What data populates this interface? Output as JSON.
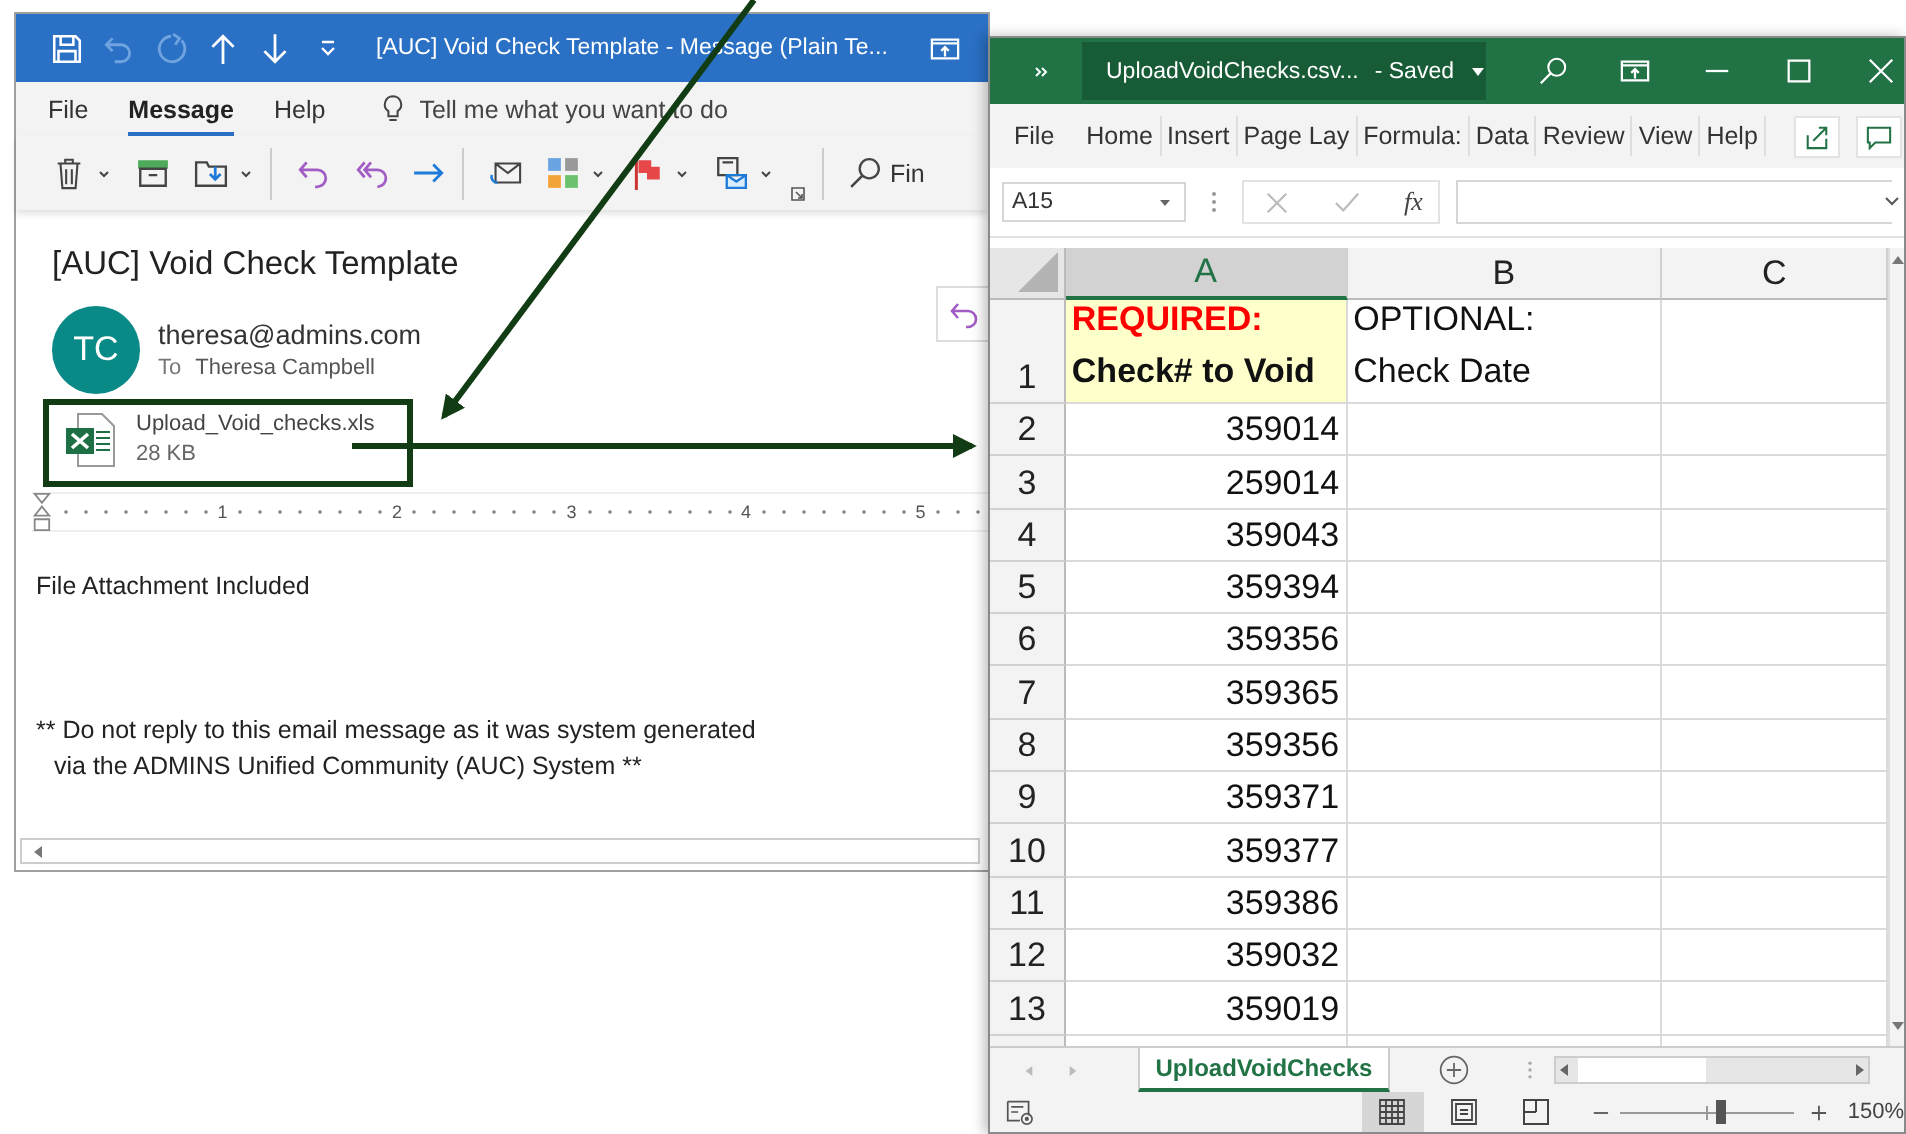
{
  "outlook": {
    "title": "[AUC] Void Check Template  -  Message (Plain Te...",
    "tabs": [
      {
        "label": "File",
        "selected": false
      },
      {
        "label": "Message",
        "selected": true
      },
      {
        "label": "Help",
        "selected": false
      }
    ],
    "tell_me": "Tell me what you want to do",
    "find": "Fin",
    "message": {
      "subject": "[AUC] Void Check Template",
      "avatar_initials": "TC",
      "sender": "theresa@admins.com",
      "to_label": "To",
      "to": "Theresa Campbell",
      "attachment": {
        "name": "Upload_Void_checks.xls",
        "size": "28 KB"
      },
      "ruler_marks": [
        "1",
        "2",
        "3",
        "4",
        "5"
      ],
      "body": [
        "File Attachment Included"
      ],
      "disclaimer": [
        "** Do not reply to this email message as it was system generated",
        "via the ADMINS Unified Community (AUC) System **"
      ]
    }
  },
  "excel": {
    "file_name": "UploadVoidChecks.csv...",
    "save_state": "- Saved",
    "tabs": [
      "File",
      "Home",
      "Insert",
      "Page Lay",
      "Formula:",
      "Data",
      "Review",
      "View",
      "Help"
    ],
    "name_box": "A15",
    "function_label": "fx",
    "columns": [
      {
        "label": "A",
        "selected": true
      },
      {
        "label": "B",
        "selected": false
      },
      {
        "label": "C",
        "selected": false
      }
    ],
    "header_row": {
      "number": "1",
      "cells": [
        {
          "kind": "required",
          "lines": [
            "REQUIRED:",
            "Check# to Void"
          ]
        },
        {
          "kind": "optional",
          "lines": [
            "OPTIONAL:",
            "Check Date"
          ]
        }
      ]
    },
    "rows": [
      {
        "number": "2",
        "check": "359014"
      },
      {
        "number": "3",
        "check": "259014"
      },
      {
        "number": "4",
        "check": "359043"
      },
      {
        "number": "5",
        "check": "359394"
      },
      {
        "number": "6",
        "check": "359356"
      },
      {
        "number": "7",
        "check": "359365"
      },
      {
        "number": "8",
        "check": "359356"
      },
      {
        "number": "9",
        "check": "359371"
      },
      {
        "number": "10",
        "check": "359377"
      },
      {
        "number": "11",
        "check": "359386"
      },
      {
        "number": "12",
        "check": "359032"
      },
      {
        "number": "13",
        "check": "359019"
      }
    ],
    "sheet_tab": {
      "label": "UploadVoidChecks",
      "selected": true
    },
    "zoom": {
      "level": 0.58,
      "reading": "150%"
    }
  }
}
